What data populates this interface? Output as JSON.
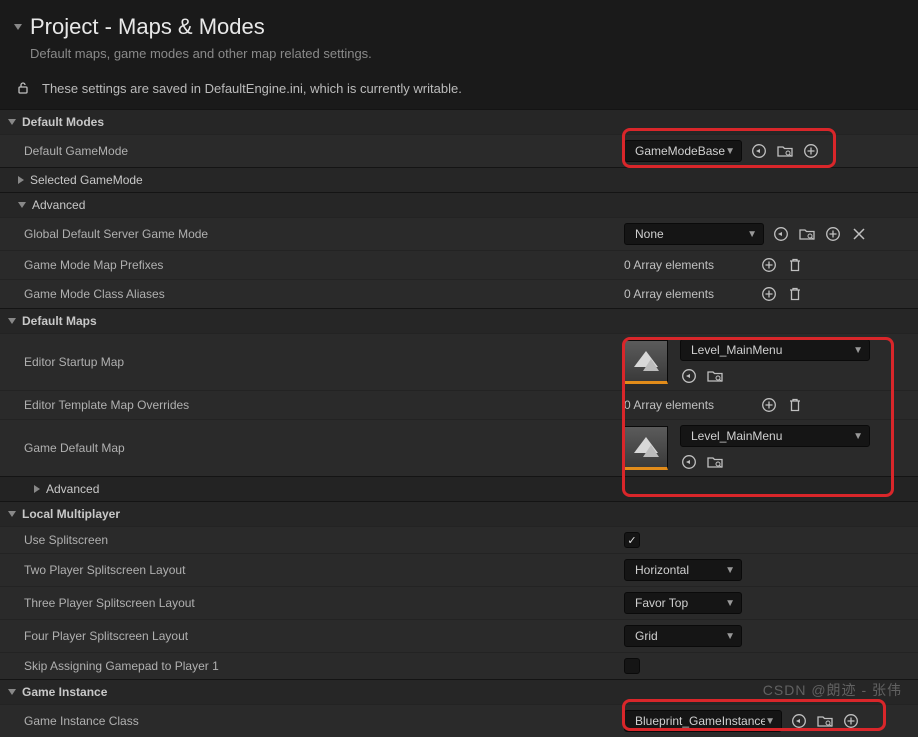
{
  "header": {
    "title": "Project - Maps & Modes",
    "subtitle": "Default maps, game modes and other map related settings.",
    "saved_text": "These settings are saved in DefaultEngine.ini, which is currently writable."
  },
  "sections": {
    "default_modes": {
      "title": "Default Modes"
    },
    "selected_gamemode": {
      "title": "Selected GameMode"
    },
    "advanced": {
      "title": "Advanced"
    },
    "default_maps": {
      "title": "Default Maps"
    },
    "advanced2": {
      "title": "Advanced"
    },
    "local_multi": {
      "title": "Local Multiplayer"
    },
    "game_instance": {
      "title": "Game Instance"
    }
  },
  "rows": {
    "default_gamemode": {
      "label": "Default GameMode",
      "value": "GameModeBase"
    },
    "global_server": {
      "label": "Global Default Server Game Mode",
      "value": "None"
    },
    "map_prefixes": {
      "label": "Game Mode Map Prefixes",
      "value": "0 Array elements"
    },
    "class_aliases": {
      "label": "Game Mode Class Aliases",
      "value": "0 Array elements"
    },
    "editor_startup": {
      "label": "Editor Startup Map",
      "value": "Level_MainMenu"
    },
    "template_overrides": {
      "label": "Editor Template Map Overrides",
      "value": "0 Array elements"
    },
    "game_default_map": {
      "label": "Game Default Map",
      "value": "Level_MainMenu"
    },
    "use_split": {
      "label": "Use Splitscreen",
      "checked": true
    },
    "two_player": {
      "label": "Two Player Splitscreen Layout",
      "value": "Horizontal"
    },
    "three_player": {
      "label": "Three Player Splitscreen Layout",
      "value": "Favor Top"
    },
    "four_player": {
      "label": "Four Player Splitscreen Layout",
      "value": "Grid"
    },
    "skip_gamepad": {
      "label": "Skip Assigning Gamepad to Player 1"
    },
    "instance_class": {
      "label": "Game Instance Class",
      "value": "Blueprint_GameInstance"
    }
  },
  "icons": {
    "reset": "reset",
    "browse": "browse",
    "add": "add",
    "trash": "trash",
    "clear": "clear"
  },
  "watermark": "CSDN @朗迹 - 张伟"
}
